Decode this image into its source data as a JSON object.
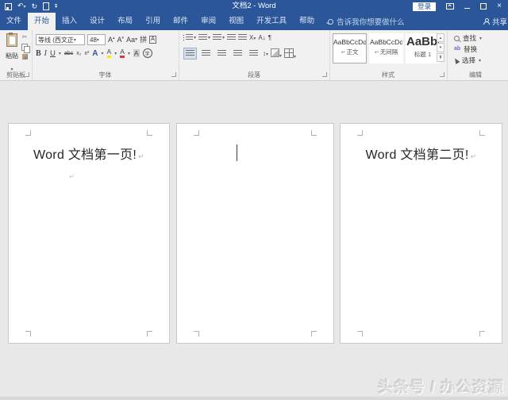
{
  "colors": {
    "accent": "#2b579a",
    "ribbon_bg": "#f1f1f1",
    "doc_bg": "#e8e8e8",
    "watermark": "#dadada"
  },
  "icons": {
    "dropdown": "▾",
    "undo": "↶",
    "redo": "↻",
    "cut": "✂",
    "minimize": "–",
    "close": "×",
    "up": "▴",
    "down": "▾",
    "sort": "A↓",
    "pilcrow": "¶",
    "asian_layout": "X",
    "line_spacing": "↕"
  },
  "title_bar": {
    "title": "文档2 - Word",
    "sign_in": "登录"
  },
  "tab_bar": {
    "tabs": [
      "文件",
      "开始",
      "插入",
      "设计",
      "布局",
      "引用",
      "邮件",
      "审阅",
      "视图",
      "开发工具",
      "帮助"
    ],
    "active_tab": "开始",
    "search_placeholder": "告诉我你想要做什么",
    "share": "共享"
  },
  "ribbon": {
    "clipboard": {
      "group_label": "剪贴板",
      "paste_label": "粘贴"
    },
    "font": {
      "group_label": "字体",
      "font_name": "等线 (西文正",
      "font_size": "48",
      "grow": "A",
      "shrink": "A",
      "case_label": "Aa",
      "phonetic": "拼",
      "char_border": "A",
      "bold": "B",
      "italic": "I",
      "underline": "U",
      "strike": "abc",
      "subscript": "x₂",
      "superscript": "x²",
      "effects": "A",
      "highlight": "A",
      "color": "A",
      "shading": "A",
      "enclose": "字"
    },
    "paragraph": {
      "group_label": "段落"
    },
    "styles": {
      "group_label": "样式",
      "items": [
        {
          "preview": "AaBbCcDd",
          "name": "正文",
          "selected": true
        },
        {
          "preview": "AaBbCcDd",
          "name": "无间隔",
          "selected": false
        },
        {
          "preview": "AaBbC",
          "name": "标题 1",
          "selected": false
        }
      ]
    },
    "editing": {
      "group_label": "编辑",
      "find": "查找",
      "replace": "替换",
      "select": "选择"
    }
  },
  "document": {
    "pages": [
      {
        "text": "Word 文档第一页!"
      },
      {
        "text": ""
      },
      {
        "text": "Word 文档第二页!"
      }
    ]
  },
  "watermark": {
    "text": "头条号 / 办公资源"
  }
}
